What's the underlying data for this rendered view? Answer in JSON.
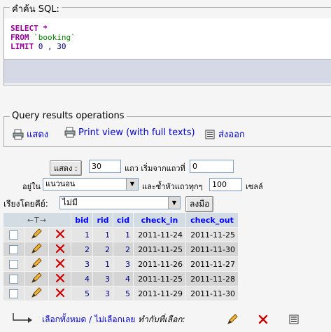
{
  "sql_box": {
    "legend": "คำค้น SQL:",
    "lines": [
      {
        "kw": "SELECT",
        "rest": " *"
      },
      {
        "kw": "FROM",
        "rest": " `booking`"
      },
      {
        "kw": "LIMIT",
        "rest": " 0 , 30"
      }
    ]
  },
  "operations": {
    "legend": "Query results operations",
    "items": [
      {
        "label": "แสดง",
        "icon": "print-icon"
      },
      {
        "label": "Print view (with full texts)",
        "icon": "print-view-icon"
      },
      {
        "label": "ส่งออก",
        "icon": "export-icon"
      }
    ]
  },
  "nav": {
    "show_button": "แสดง :",
    "rows_value": "30",
    "start_label": "แถว เริ่มจากแถวที่",
    "start_value": "0",
    "mode_label": "อยู่ใน",
    "mode_value": "แนวนอน",
    "repeat_label": "และซ้ำหัวแถวทุกๆ",
    "repeat_value": "100",
    "cells_label": "เซลล์",
    "sort_label": "เรียงโดยคีย์:",
    "sort_value": "ไม่มี",
    "go_button": "ลงมือ"
  },
  "table": {
    "nav_arrows": "←T→",
    "columns": [
      "bid",
      "rid",
      "cid",
      "check_in",
      "check_out"
    ],
    "rows": [
      [
        "1",
        "1",
        "1",
        "2011-11-24",
        "2011-11-25"
      ],
      [
        "2",
        "2",
        "2",
        "2011-11-25",
        "2011-11-30"
      ],
      [
        "3",
        "1",
        "3",
        "2011-11-26",
        "2011-11-27"
      ],
      [
        "4",
        "3",
        "4",
        "2011-11-25",
        "2011-11-28"
      ],
      [
        "5",
        "3",
        "5",
        "2011-11-29",
        "2011-11-30"
      ]
    ]
  },
  "footer": {
    "check_all": "เลือกทั้งหมด",
    "separator": " / ",
    "uncheck_all": "ไม่เลือกเลย",
    "with_selected": "ทำกับที่เลือก:"
  },
  "colors": {
    "header_bg": "#d3dce3",
    "keyword": "#990099",
    "link": "#0000cc"
  }
}
